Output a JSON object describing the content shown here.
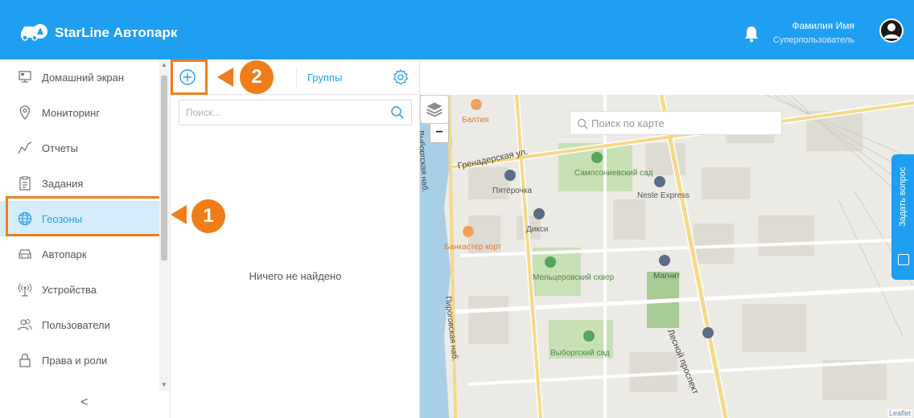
{
  "header": {
    "brand": "StarLine Автопарк",
    "user_name": "Фамилия Имя",
    "user_role": "Суперпользователь"
  },
  "sidebar": {
    "items": [
      {
        "label": "Домашний экран",
        "icon": "home-screen-icon"
      },
      {
        "label": "Мониторинг",
        "icon": "location-pin-icon"
      },
      {
        "label": "Отчеты",
        "icon": "chart-line-icon"
      },
      {
        "label": "Задания",
        "icon": "clipboard-icon"
      },
      {
        "label": "Геозоны",
        "icon": "globe-icon",
        "active": true
      },
      {
        "label": "Автопарк",
        "icon": "car-icon"
      },
      {
        "label": "Устройства",
        "icon": "antenna-icon"
      },
      {
        "label": "Пользователи",
        "icon": "users-icon"
      },
      {
        "label": "Права и роли",
        "icon": "lock-icon"
      }
    ],
    "collapse_label": "<"
  },
  "panel": {
    "groups_tab": "Группы",
    "search_placeholder": "Поиск...",
    "empty_text": "Ничего не найдено"
  },
  "callouts": {
    "one": "1",
    "two": "2"
  },
  "map": {
    "search_placeholder": "Поиск по карте",
    "zoom_in": "+",
    "zoom_out": "−",
    "ask_question": "Задать вопрос",
    "attribution": "Leaflet",
    "labels": {
      "street1": "Гренадерская ул.",
      "embankment": "Выборгская наб.",
      "street2": "Пироговская наб.",
      "avenue": "Лесной проспект",
      "park1": "Сампсониевский сад",
      "park2": "Мельцеровский сквер",
      "park3": "Выборгский сад",
      "poi1": "Пятёрочка",
      "poi2": "Дикси",
      "poi3": "Neste Express",
      "poi4": "Магнит",
      "poi5": "Банкастер корт",
      "poi6": "Балтия"
    }
  },
  "colors": {
    "accent": "#1e9ff2",
    "callout": "#f07d1a",
    "active_bg": "#d6ecfb"
  }
}
